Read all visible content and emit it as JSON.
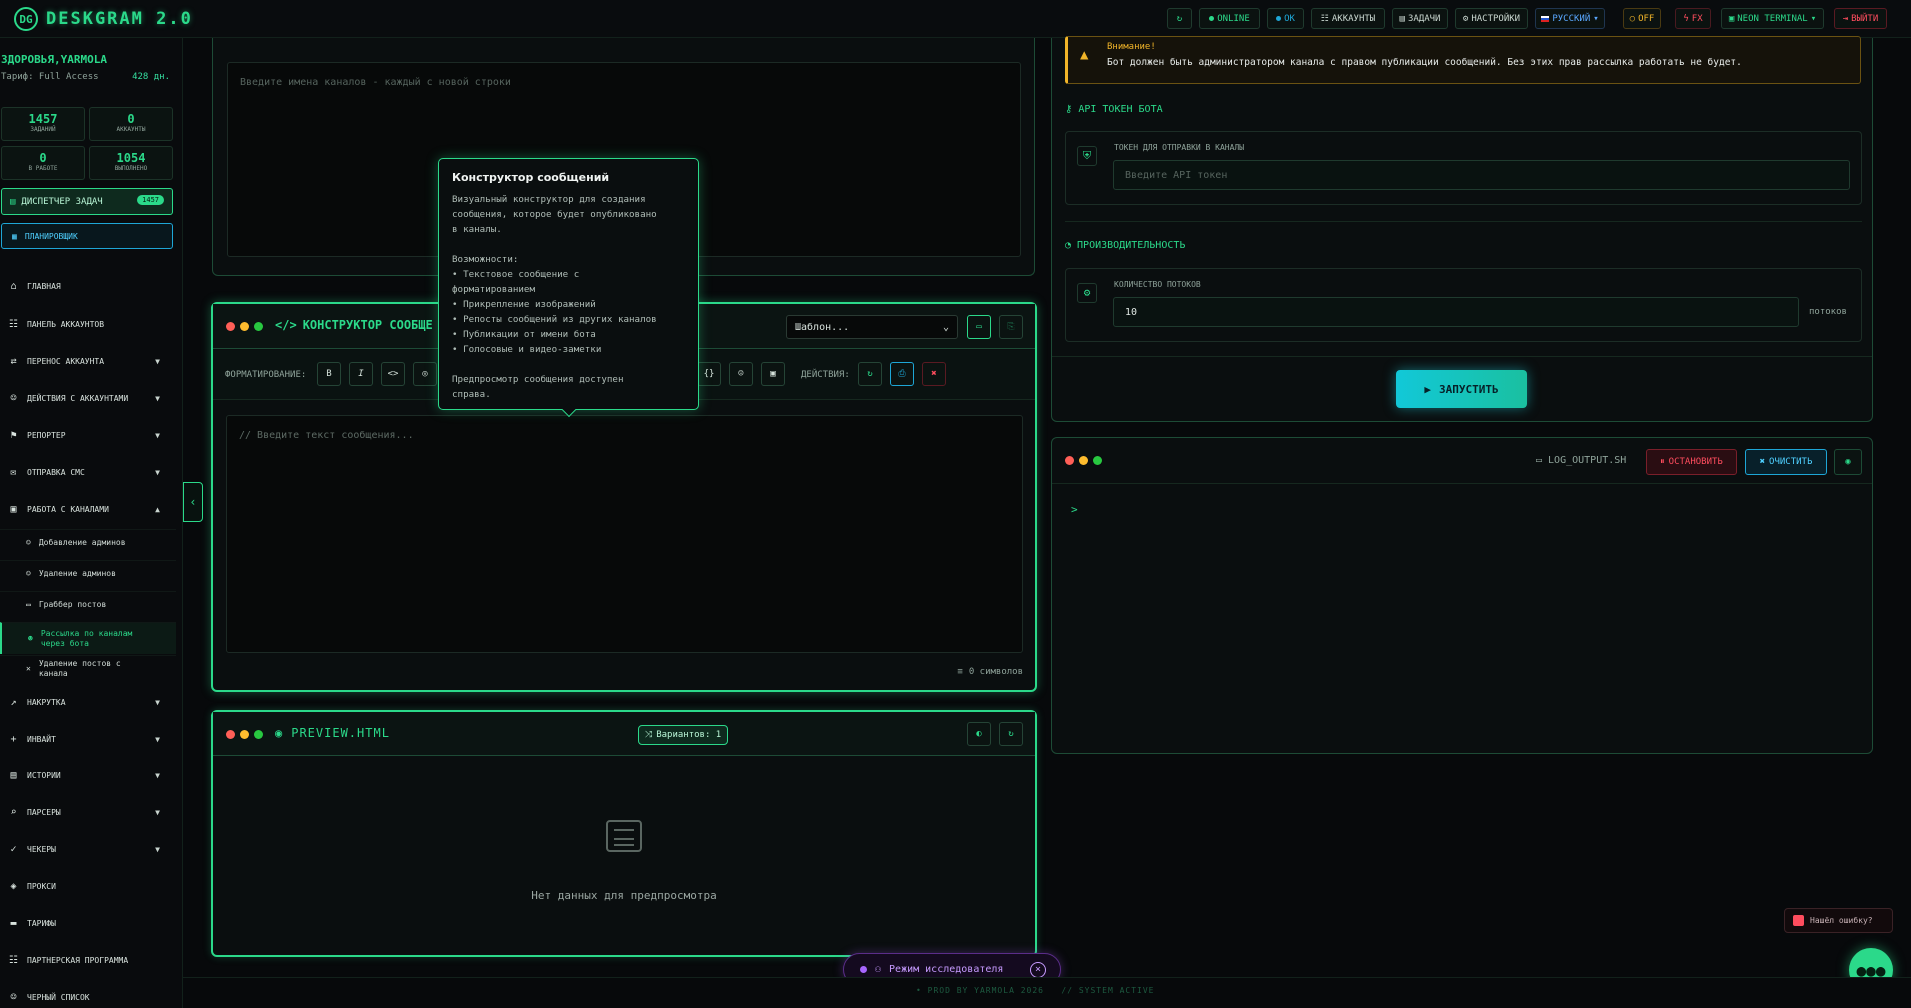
{
  "app": {
    "logo_mark": "DG",
    "title": "DESKGRAM 2.0"
  },
  "topbar": {
    "refresh_icon": "↻",
    "online": "ONLINE",
    "ok": "OK",
    "accounts": "АККАУНТЫ",
    "tasks": "ЗАДАЧИ",
    "settings": "НАСТРОЙКИ",
    "language": "РУССКИЙ",
    "off": "OFF",
    "fx": "FX",
    "theme": "NEON TERMINAL",
    "logout": "ВЫЙТИ"
  },
  "user": {
    "name": "ЗДОРОВЬЯ,YARMOLA",
    "plan": "Тариф: Full Access",
    "days": "428 дн."
  },
  "stats": [
    {
      "value": "1457",
      "label": "Заданий"
    },
    {
      "value": "0",
      "label": "Аккаунты"
    },
    {
      "value": "0",
      "label": "В работе"
    },
    {
      "value": "1054",
      "label": "Выполнено"
    }
  ],
  "sidebar": {
    "dispatcher": "Диспетчер задач",
    "dispatcher_badge": "1457",
    "planner": "Планировщик",
    "items": [
      {
        "label": "Главная",
        "icon": "⌂",
        "chevron": ""
      },
      {
        "label": "Панель аккаунтов",
        "icon": "☷",
        "chevron": ""
      },
      {
        "label": "Перенос аккаунта",
        "icon": "⇄",
        "chevron": "▼"
      },
      {
        "label": "Действия с аккаунтами",
        "icon": "☺",
        "chevron": "▼"
      },
      {
        "label": "Репортер",
        "icon": "⚑",
        "chevron": "▼"
      },
      {
        "label": "Отправка смс",
        "icon": "✉",
        "chevron": "▼"
      },
      {
        "label": "Работа с каналами",
        "icon": "▣",
        "chevron": "▲"
      }
    ],
    "subitems": [
      {
        "label": "Добавление админов",
        "icon": "☺",
        "active": false
      },
      {
        "label": "Удаление админов",
        "icon": "☺",
        "active": false
      },
      {
        "label": "Граббер постов",
        "icon": "▭",
        "active": false
      },
      {
        "label": "Рассылка по каналам через бота",
        "icon": "☻",
        "active": true
      },
      {
        "label": "Удаление постов с канала",
        "icon": "✕",
        "active": false
      }
    ],
    "items2": [
      {
        "label": "Накрутка",
        "icon": "↗",
        "chevron": "▼"
      },
      {
        "label": "Инвайт",
        "icon": "+",
        "chevron": "▼"
      },
      {
        "label": "Истории",
        "icon": "▤",
        "chevron": "▼"
      },
      {
        "label": "Парсеры",
        "icon": "⌕",
        "chevron": "▼"
      },
      {
        "label": "Чекеры",
        "icon": "✓",
        "chevron": "▼"
      },
      {
        "label": "Прокси",
        "icon": "◈",
        "chevron": ""
      },
      {
        "label": "Тарифы",
        "icon": "▬",
        "chevron": ""
      },
      {
        "label": "Партнерская программа",
        "icon": "☷",
        "chevron": ""
      },
      {
        "label": "Черный список",
        "icon": "☺",
        "chevron": ""
      }
    ]
  },
  "channels": {
    "placeholder": "Введите имена каналов - каждый с новой строки"
  },
  "constructor": {
    "title": "КОНСТРУКТОР СООБЩЕ",
    "template_select": "Шаблон...",
    "format_label": "ФОРМАТИРОВАНИЕ:",
    "fmt_buttons": [
      "B",
      "I",
      "<>"
    ],
    "actions_label": "ДЕЙСТВИЯ:",
    "text_placeholder": "// Введите текст сообщения...",
    "char_count": "0 символов"
  },
  "tooltip": {
    "title": "Конструктор сообщений",
    "lines": [
      "Визуальный конструктор для создания",
      "сообщения, которое будет опубликовано",
      "в каналы.",
      "",
      "Возможности:",
      "• Текстовое сообщение с",
      "форматированием",
      "• Прикрепление изображений",
      "• Репосты сообщений из других каналов",
      "• Публикации от имени бота",
      "• Голосовые и видео-заметки",
      "",
      "Предпросмотр сообщения доступен",
      "справа."
    ]
  },
  "preview": {
    "title": "PREVIEW.HTML",
    "variants": "Вариантов: 1",
    "empty": "Нет данных для предпросмотра"
  },
  "warning": {
    "title": "Внимание!",
    "text": "Бот должен быть администратором канала с правом публикации сообщений. Без этих прав рассылка работать не будет."
  },
  "token": {
    "section": "API ТОКЕН БОТА",
    "label": "ТОКЕН ДЛЯ ОТПРАВКИ В КАНАЛЫ",
    "placeholder": "Введите API токен"
  },
  "perf": {
    "section": "ПРОИЗВОДИТЕЛЬНОСТЬ",
    "label": "КОЛИЧЕСТВО ПОТОКОВ",
    "threads": "10",
    "unit": "потоков"
  },
  "launch": "ЗАПУСТИТЬ",
  "log": {
    "title": "LOG_OUTPUT.SH",
    "stop": "ОСТАНОВИТЬ",
    "clear": "ОЧИСТИТЬ",
    "prompt": ">"
  },
  "bug": "Нашёл ошибку?",
  "explorer": "Режим исследователя",
  "footer": "• PROD BY YARMOLA 2026   // SYSTEM ACTIVE",
  "colors": {
    "accent": "#2bd98a",
    "cyan": "#12c8d8",
    "danger": "#ff4d5e",
    "warn": "#f0b429"
  }
}
